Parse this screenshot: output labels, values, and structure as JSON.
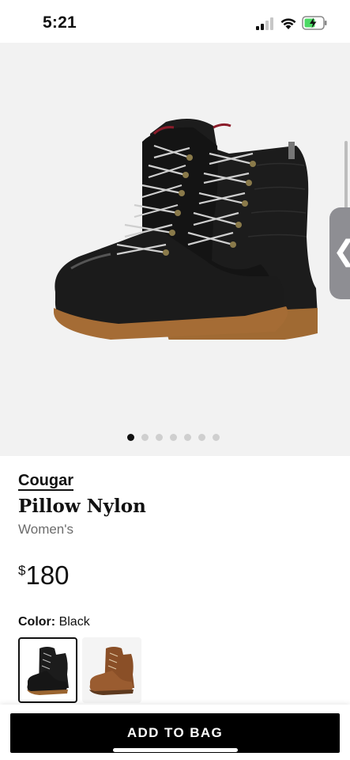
{
  "status_bar": {
    "time": "5:21"
  },
  "gallery": {
    "image_alt": "Black leather and nylon lace-up winter boots",
    "dot_count": 7,
    "active_dot": 1,
    "side_tab_glyph": "❮"
  },
  "product": {
    "brand": "Cougar",
    "name": "Pillow Nylon",
    "category": "Women's",
    "price_symbol": "$",
    "price_value": "180",
    "color_label": "Color:",
    "color_value": "Black"
  },
  "swatches": [
    {
      "name": "Black",
      "selected": true
    },
    {
      "name": "Brown",
      "selected": false
    }
  ],
  "actions": {
    "add_to_bag": "ADD TO BAG"
  },
  "colors": {
    "accent": "#000000",
    "gallery_bg": "#f2f2f2",
    "battery_charging": "#4cd964"
  }
}
